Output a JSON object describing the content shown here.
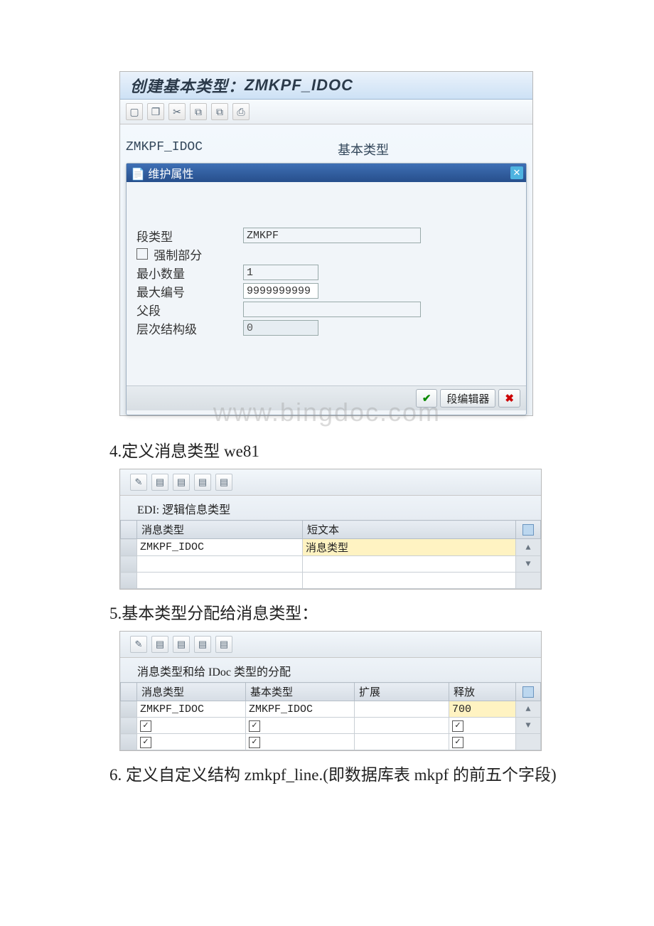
{
  "sap1": {
    "title_prefix": "创建基本类型：",
    "title_code": "ZMKPF_IDOC",
    "toolbar_icons": [
      "new-icon",
      "copy-icon",
      "cut-icon",
      "paste1-icon",
      "paste2-icon",
      "print-icon"
    ],
    "field_code": "ZMKPF_IDOC",
    "field_kind": "基本类型",
    "popup": {
      "title_icon": "maintain-icon",
      "title": "维护属性",
      "close_icon": "close-icon",
      "rows": {
        "seg_type_label": "段类型",
        "seg_type_value": "ZMKPF",
        "mandatory_label": "强制部分",
        "min_label": "最小数量",
        "min_value": "1",
        "max_label": "最大编号",
        "max_value": "9999999999",
        "parent_label": "父段",
        "parent_value": "",
        "level_label": "层次结构级",
        "level_value": "0"
      },
      "footer": {
        "ok_icon": "check-green-icon",
        "seg_editor_label": "段编辑器",
        "cancel_icon": "x-red-icon"
      }
    }
  },
  "watermark": "www.bingdoc.com",
  "step4": "4.定义消息类型 we81",
  "sap2": {
    "toolbar_icons": [
      "pencil-icon",
      "newrow-icon",
      "copyrow-icon",
      "delrow-icon",
      "selectall-icon"
    ],
    "caption": "EDI: 逻辑信息类型",
    "cols": {
      "c1": "消息类型",
      "c2": "短文本"
    },
    "rows": [
      {
        "c1": "ZMKPF_IDOC",
        "c2": "消息类型",
        "hl": true
      },
      {
        "c1": "",
        "c2": "",
        "hl": false
      },
      {
        "c1": "",
        "c2": "",
        "hl": false
      }
    ]
  },
  "step5": "5.基本类型分配给消息类型：",
  "sap3": {
    "toolbar_icons": [
      "pencil-icon",
      "newrow-icon",
      "copyrow-icon",
      "delrow-icon",
      "selectall-icon"
    ],
    "caption": "消息类型和给 IDoc 类型的分配",
    "cols": {
      "c1": "消息类型",
      "c2": "基本类型",
      "c3": "扩展",
      "c4": "释放"
    },
    "rows": [
      {
        "c1": "ZMKPF_IDOC",
        "c2": "ZMKPF_IDOC",
        "c3": "",
        "c4": "700",
        "hl4": true,
        "checks": false
      },
      {
        "c1": "",
        "c2": "",
        "c3": "",
        "c4": "",
        "checks": true
      },
      {
        "c1": "",
        "c2": "",
        "c3": "",
        "c4": "",
        "checks": true
      }
    ]
  },
  "step6": "6. 定义自定义结构 zmkpf_line.(即数据库表 mkpf 的前五个字段)"
}
